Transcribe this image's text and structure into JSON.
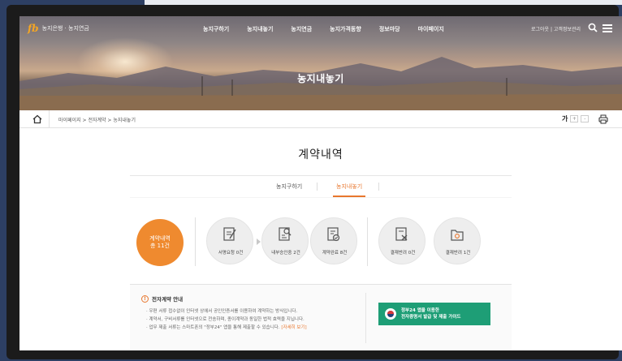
{
  "header": {
    "logo_mark": "fb",
    "logo_text": "농지은행 · 농지연금",
    "menu": [
      "농지구하기",
      "농지내놓기",
      "농지연금",
      "농지가격동향",
      "정보마당",
      "마이페이지"
    ],
    "util_text": "로그아웃  |  고객정보관리",
    "hero_title": "농지내놓기"
  },
  "breadcrumb": {
    "path": "마이페이지  >  전자계약  >  농지내놓기",
    "font_label": "가",
    "font_plus": "+",
    "font_minus": "-"
  },
  "main": {
    "title": "계약내역",
    "tabs": [
      {
        "label": "농지구하기",
        "active": false
      },
      {
        "label": "농지내놓기",
        "active": true
      }
    ],
    "total": {
      "line1": "계약내역",
      "line2": "총 11건"
    },
    "stats": [
      {
        "label": "서명요청 0건",
        "icon": "document-sign-icon"
      },
      {
        "label": "내부승인중 2건",
        "icon": "document-search-icon"
      },
      {
        "label": "계약완료 8건",
        "icon": "document-check-icon"
      },
      {
        "label": "결재반려 0건",
        "icon": "document-reject-icon"
      },
      {
        "label": "결재반려 1건",
        "icon": "folder-icon"
      }
    ]
  },
  "guide": {
    "title": "전자계약 안내",
    "lines": [
      "· 우편 서류 접수없이 인터넷 상에서 공인인증서를 이용하여 계약하는 방식입니다.",
      "· 계약서, 구비서류를 인터넷으로 전송하며, 종이계약과 동일한 법적 효력을 지닙니다.",
      "· 업무 제출 서류는 스마트폰의 \"정부24\" 앱을 통해 제출할 수 있습니다."
    ],
    "link_text": "[자세히 보기]",
    "gov_button": {
      "line1": "정부24 앱을 이용한",
      "line2": "전자증명서 발급 및 제출 가이드"
    }
  },
  "colors": {
    "accent": "#e8772e",
    "total_circle": "#ef8a2f",
    "gov_button": "#1e9e76",
    "frame": "#1b1b1b",
    "background": "#2d3f63"
  }
}
